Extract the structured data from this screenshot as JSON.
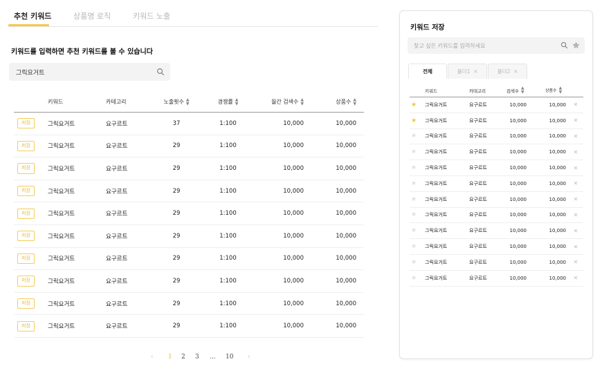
{
  "tabs": [
    {
      "label": "추천 키워드"
    },
    {
      "label": "상품명 로직"
    },
    {
      "label": "키워드 노출"
    }
  ],
  "heading": "키워드를 입력하면 추천 키워드를 볼 수 있습니다",
  "search": {
    "value": "그릭요거트"
  },
  "main_table": {
    "headers": {
      "keyword": "키워드",
      "category": "카테고리",
      "impressions": "노출횟수",
      "competition": "경쟁률",
      "monthly_search": "월간 검색수",
      "products": "상품수"
    },
    "save_label": "저장",
    "rows": [
      {
        "keyword": "그릭요거트",
        "category": "요구르트",
        "impressions": "37",
        "competition": "1:100",
        "monthly_search": "10,000",
        "products": "10,000"
      },
      {
        "keyword": "그릭요거트",
        "category": "요구르트",
        "impressions": "29",
        "competition": "1:100",
        "monthly_search": "10,000",
        "products": "10,000"
      },
      {
        "keyword": "그릭요거트",
        "category": "요구르트",
        "impressions": "29",
        "competition": "1:100",
        "monthly_search": "10,000",
        "products": "10,000"
      },
      {
        "keyword": "그릭요거트",
        "category": "요구르트",
        "impressions": "29",
        "competition": "1:100",
        "monthly_search": "10,000",
        "products": "10,000"
      },
      {
        "keyword": "그릭요거트",
        "category": "요구르트",
        "impressions": "29",
        "competition": "1:100",
        "monthly_search": "10,000",
        "products": "10,000"
      },
      {
        "keyword": "그릭요거트",
        "category": "요구르트",
        "impressions": "29",
        "competition": "1:100",
        "monthly_search": "10,000",
        "products": "10,000"
      },
      {
        "keyword": "그릭요거트",
        "category": "요구르트",
        "impressions": "29",
        "competition": "1:100",
        "monthly_search": "10,000",
        "products": "10,000"
      },
      {
        "keyword": "그릭요거트",
        "category": "요구르트",
        "impressions": "29",
        "competition": "1:100",
        "monthly_search": "10,000",
        "products": "10,000"
      },
      {
        "keyword": "그릭요거트",
        "category": "요구르트",
        "impressions": "29",
        "competition": "1:100",
        "monthly_search": "10,000",
        "products": "10,000"
      },
      {
        "keyword": "그릭요거트",
        "category": "요구르트",
        "impressions": "29",
        "competition": "1:100",
        "monthly_search": "10,000",
        "products": "10,000"
      }
    ]
  },
  "pagination": {
    "prev": "‹",
    "pages": [
      "1",
      "2",
      "3"
    ],
    "ellipsis": "...",
    "last": "10",
    "next": "›",
    "current": "1"
  },
  "panel": {
    "title": "키워드 저장",
    "search_placeholder": "찾고 싶은 키워드를 입력하세요",
    "tabs": [
      {
        "label": "전체"
      },
      {
        "label": "폴더1"
      },
      {
        "label": "폴더2"
      }
    ],
    "headers": {
      "keyword": "키워드",
      "category": "카테고리",
      "search_volume": "검색수",
      "products": "상품수"
    },
    "rows": [
      {
        "starred": true,
        "keyword": "그릭요거트",
        "category": "요구르트",
        "search_volume": "10,000",
        "products": "10,000"
      },
      {
        "starred": true,
        "keyword": "그릭요거트",
        "category": "요구르트",
        "search_volume": "10,000",
        "products": "10,000"
      },
      {
        "starred": false,
        "keyword": "그릭요거트",
        "category": "요구르트",
        "search_volume": "10,000",
        "products": "10,000"
      },
      {
        "starred": false,
        "keyword": "그릭요거트",
        "category": "요구르트",
        "search_volume": "10,000",
        "products": "10,000"
      },
      {
        "starred": false,
        "keyword": "그릭요거트",
        "category": "요구르트",
        "search_volume": "10,000",
        "products": "10,000"
      },
      {
        "starred": false,
        "keyword": "그릭요거트",
        "category": "요구르트",
        "search_volume": "10,000",
        "products": "10,000"
      },
      {
        "starred": false,
        "keyword": "그릭요거트",
        "category": "요구르트",
        "search_volume": "10,000",
        "products": "10,000"
      },
      {
        "starred": false,
        "keyword": "그릭요거트",
        "category": "요구르트",
        "search_volume": "10,000",
        "products": "10,000"
      },
      {
        "starred": false,
        "keyword": "그릭요거트",
        "category": "요구르트",
        "search_volume": "10,000",
        "products": "10,000"
      },
      {
        "starred": false,
        "keyword": "그릭요거트",
        "category": "요구르트",
        "search_volume": "10,000",
        "products": "10,000"
      },
      {
        "starred": false,
        "keyword": "그릭요거트",
        "category": "요구르트",
        "search_volume": "10,000",
        "products": "10,000"
      },
      {
        "starred": false,
        "keyword": "그릭요거트",
        "category": "요구르트",
        "search_volume": "10,000",
        "products": "10,000"
      }
    ]
  },
  "icons": {
    "search": "search-icon",
    "star": "star-icon",
    "sort": "sort-icon",
    "remove": "close-icon"
  },
  "colors": {
    "accent": "#f5c94b",
    "star_on": "#f3c43f",
    "star_off": "#dedede"
  }
}
